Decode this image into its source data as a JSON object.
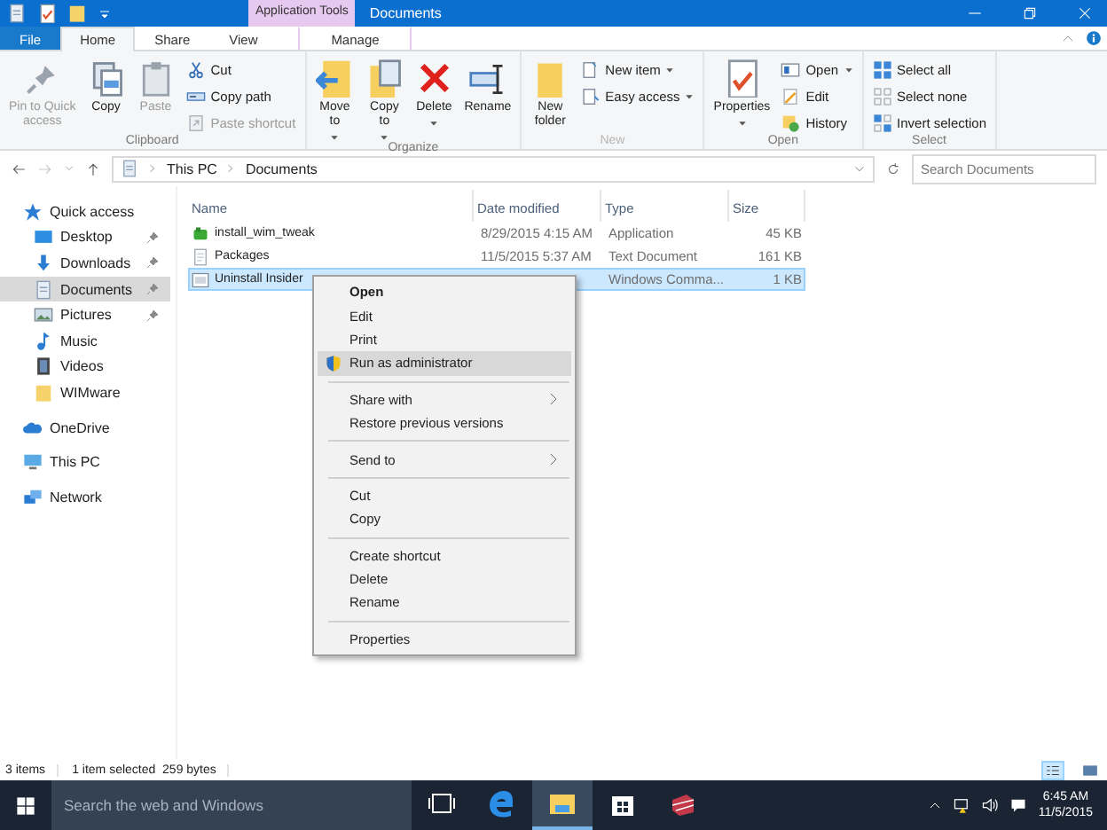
{
  "title_bar": {
    "context_tab": "Application Tools",
    "title": "Documents"
  },
  "ribbon_tabs": [
    {
      "label": "File",
      "kind": "file",
      "selected": false
    },
    {
      "label": "Home",
      "kind": "tab",
      "selected": true
    },
    {
      "label": "Share",
      "kind": "tab",
      "selected": false
    },
    {
      "label": "View",
      "kind": "tab",
      "selected": false
    },
    {
      "label": "Manage",
      "kind": "context",
      "selected": false
    }
  ],
  "ribbon_groups": [
    {
      "label": "Clipboard",
      "disabled": false,
      "large": [
        {
          "label": "Pin to Quick\naccess",
          "disabled": true,
          "dropdown": false
        },
        {
          "label": "Copy",
          "disabled": false,
          "dropdown": false
        },
        {
          "label": "Paste",
          "disabled": true,
          "dropdown": false
        }
      ],
      "small": [
        {
          "label": "Cut",
          "disabled": false,
          "dropdown": false
        },
        {
          "label": "Copy path",
          "disabled": false,
          "dropdown": false
        },
        {
          "label": "Paste shortcut",
          "disabled": true,
          "dropdown": false
        }
      ]
    },
    {
      "label": "Organize",
      "disabled": false,
      "large": [
        {
          "label": "Move\nto",
          "disabled": false,
          "dropdown": true
        },
        {
          "label": "Copy\nto",
          "disabled": false,
          "dropdown": true
        },
        {
          "label": "Delete",
          "disabled": false,
          "dropdown": true
        },
        {
          "label": "Rename",
          "disabled": false,
          "dropdown": false
        }
      ]
    },
    {
      "label": "New",
      "disabled": true,
      "large": [
        {
          "label": "New\nfolder",
          "disabled": false,
          "dropdown": false
        }
      ],
      "small": [
        {
          "label": "New item",
          "disabled": false,
          "dropdown": true
        },
        {
          "label": "Easy access",
          "disabled": false,
          "dropdown": true
        }
      ]
    },
    {
      "label": "Open",
      "disabled": false,
      "large": [
        {
          "label": "Properties",
          "disabled": false,
          "dropdown": true
        }
      ],
      "small": [
        {
          "label": "Open",
          "disabled": false,
          "dropdown": true
        },
        {
          "label": "Edit",
          "disabled": false,
          "dropdown": false
        },
        {
          "label": "History",
          "disabled": false,
          "dropdown": false
        }
      ]
    },
    {
      "label": "Select",
      "disabled": false,
      "small": [
        {
          "label": "Select all",
          "disabled": false,
          "dropdown": false
        },
        {
          "label": "Select none",
          "disabled": false,
          "dropdown": false
        },
        {
          "label": "Invert selection",
          "disabled": false,
          "dropdown": false
        }
      ]
    }
  ],
  "address_bar": {
    "path": [
      "This PC",
      "Documents"
    ],
    "search_placeholder": "Search Documents"
  },
  "nav": [
    {
      "label": "Quick access",
      "pinned": false,
      "selected": false,
      "children": [
        {
          "label": "Desktop",
          "pinned": true,
          "selected": false
        },
        {
          "label": "Downloads",
          "pinned": true,
          "selected": false
        },
        {
          "label": "Documents",
          "pinned": true,
          "selected": true
        },
        {
          "label": "Pictures",
          "pinned": true,
          "selected": false
        },
        {
          "label": "Music",
          "pinned": false,
          "selected": false
        },
        {
          "label": "Videos",
          "pinned": false,
          "selected": false
        },
        {
          "label": "WIMware",
          "pinned": false,
          "selected": false
        }
      ]
    },
    {
      "label": "OneDrive",
      "pinned": false,
      "selected": false
    },
    {
      "label": "This PC",
      "pinned": false,
      "selected": false
    },
    {
      "label": "Network",
      "pinned": false,
      "selected": false
    }
  ],
  "file_list": {
    "columns": [
      "Name",
      "Date modified",
      "Type",
      "Size"
    ],
    "rows": [
      {
        "name": "install_wim_tweak",
        "date": "8/29/2015 4:15 AM",
        "type": "Application",
        "size": "45 KB",
        "selected": false
      },
      {
        "name": "Packages",
        "date": "11/5/2015 5:37 AM",
        "type": "Text Document",
        "size": "161 KB",
        "selected": false
      },
      {
        "name": "Uninstall Insider",
        "type": "Windows Comma...",
        "size": "1 KB",
        "selected": true
      }
    ]
  },
  "context_menu": [
    {
      "kind": "item",
      "label": "Open",
      "default": true,
      "highlighted": false,
      "submenu": false
    },
    {
      "kind": "item",
      "label": "Edit",
      "default": false,
      "highlighted": false,
      "submenu": false
    },
    {
      "kind": "item",
      "label": "Print",
      "default": false,
      "highlighted": false,
      "submenu": false
    },
    {
      "kind": "item",
      "label": "Run as administrator",
      "default": false,
      "highlighted": true,
      "submenu": false
    },
    {
      "kind": "separator"
    },
    {
      "kind": "item",
      "label": "Share with",
      "default": false,
      "highlighted": false,
      "submenu": true
    },
    {
      "kind": "item",
      "label": "Restore previous versions",
      "default": false,
      "highlighted": false,
      "submenu": false
    },
    {
      "kind": "separator"
    },
    {
      "kind": "item",
      "label": "Send to",
      "default": false,
      "highlighted": false,
      "submenu": true
    },
    {
      "kind": "separator"
    },
    {
      "kind": "item",
      "label": "Cut",
      "default": false,
      "highlighted": false,
      "submenu": false
    },
    {
      "kind": "item",
      "label": "Copy",
      "default": false,
      "highlighted": false,
      "submenu": false
    },
    {
      "kind": "separator"
    },
    {
      "kind": "item",
      "label": "Create shortcut",
      "default": false,
      "highlighted": false,
      "submenu": false
    },
    {
      "kind": "item",
      "label": "Delete",
      "default": false,
      "highlighted": false,
      "submenu": false
    },
    {
      "kind": "item",
      "label": "Rename",
      "default": false,
      "highlighted": false,
      "submenu": false
    },
    {
      "kind": "separator"
    },
    {
      "kind": "item",
      "label": "Properties",
      "default": false,
      "highlighted": false,
      "submenu": false
    }
  ],
  "status_bar": {
    "count": "3 items",
    "selection": "1 item selected  259 bytes",
    "views": [
      {
        "selected": true
      },
      {
        "selected": false
      }
    ]
  },
  "taskbar": {
    "search_placeholder": "Search the web and Windows",
    "apps": [
      {
        "active": false
      },
      {
        "active": false
      },
      {
        "active": true
      },
      {
        "active": false
      },
      {
        "active": false
      }
    ],
    "time": "6:45 AM",
    "date": "11/5/2015"
  }
}
